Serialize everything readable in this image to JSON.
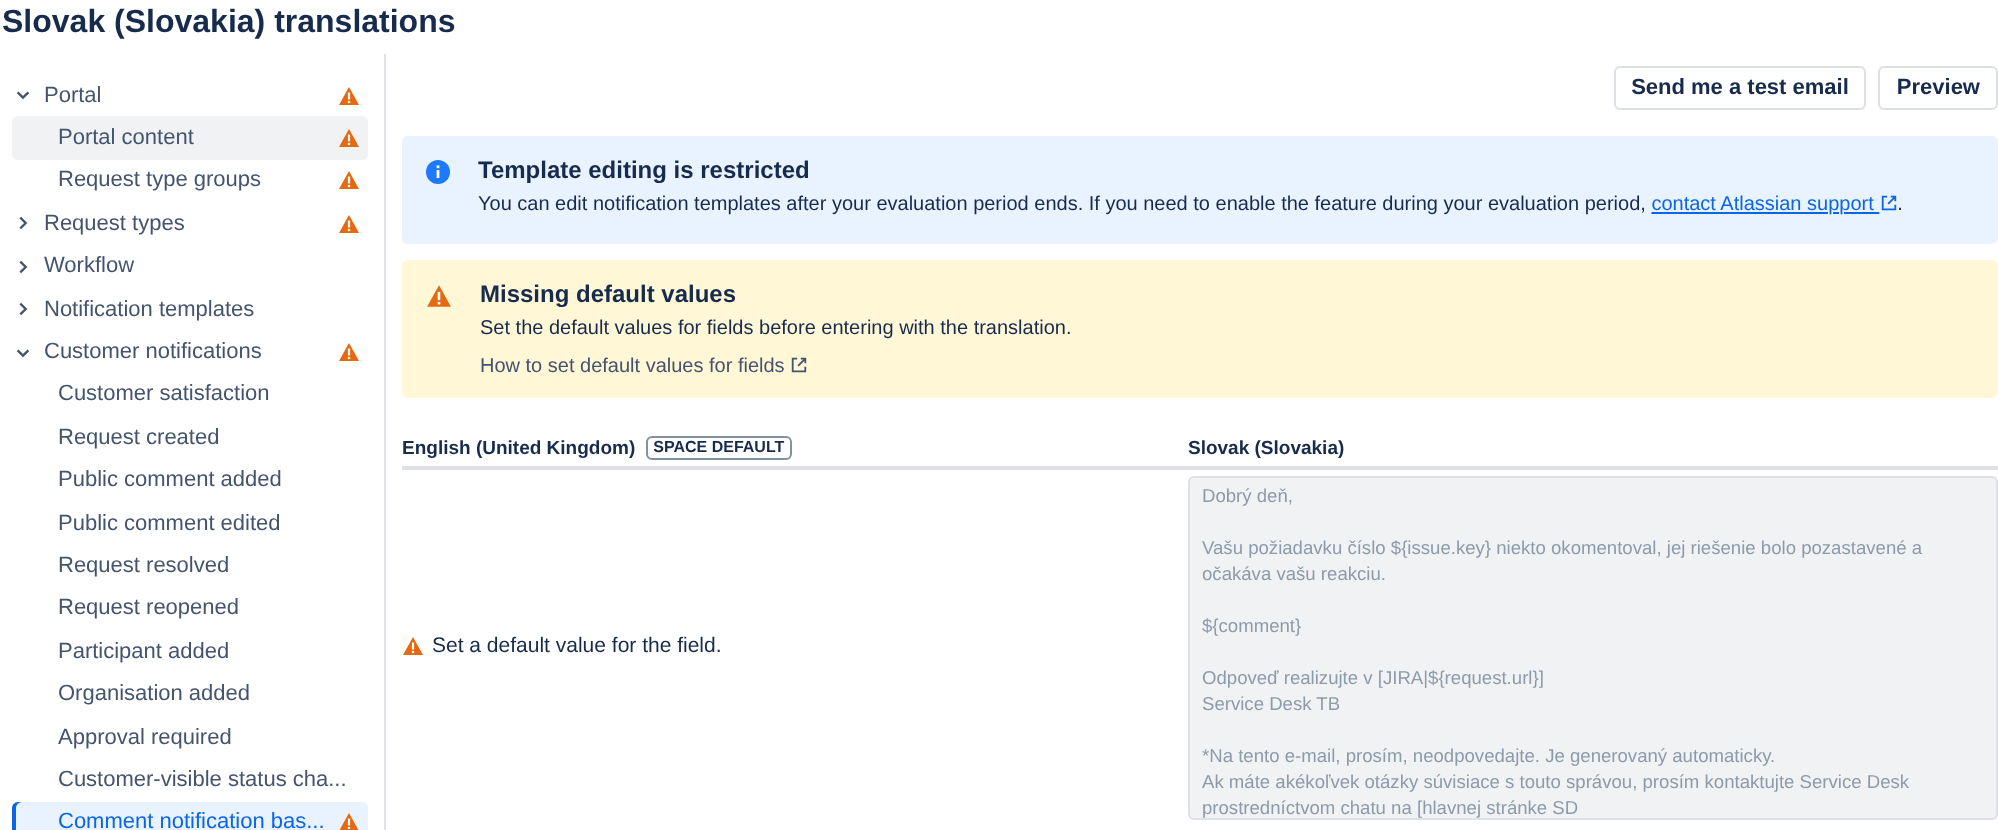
{
  "page_title": "Slovak (Slovakia) translations",
  "sidebar": {
    "items": [
      {
        "label": "Portal",
        "expanded": true,
        "warning": true,
        "selected": false,
        "hovered": false,
        "children": [
          {
            "label": "Portal content",
            "warning": true,
            "selected": false,
            "hovered": true
          },
          {
            "label": "Request type groups",
            "warning": true,
            "selected": false,
            "hovered": false
          }
        ]
      },
      {
        "label": "Request types",
        "expanded": false,
        "warning": true,
        "selected": false,
        "hovered": false
      },
      {
        "label": "Workflow",
        "expanded": false,
        "warning": false,
        "selected": false,
        "hovered": false
      },
      {
        "label": "Notification templates",
        "expanded": false,
        "warning": false,
        "selected": false,
        "hovered": false
      },
      {
        "label": "Customer notifications",
        "expanded": true,
        "warning": true,
        "selected": false,
        "hovered": false,
        "children": [
          {
            "label": "Customer satisfaction",
            "warning": false,
            "selected": false,
            "hovered": false
          },
          {
            "label": "Request created",
            "warning": false,
            "selected": false,
            "hovered": false
          },
          {
            "label": "Public comment added",
            "warning": false,
            "selected": false,
            "hovered": false
          },
          {
            "label": "Public comment edited",
            "warning": false,
            "selected": false,
            "hovered": false
          },
          {
            "label": "Request resolved",
            "warning": false,
            "selected": false,
            "hovered": false
          },
          {
            "label": "Request reopened",
            "warning": false,
            "selected": false,
            "hovered": false
          },
          {
            "label": "Participant added",
            "warning": false,
            "selected": false,
            "hovered": false
          },
          {
            "label": "Organisation added",
            "warning": false,
            "selected": false,
            "hovered": false
          },
          {
            "label": "Approval required",
            "warning": false,
            "selected": false,
            "hovered": false
          },
          {
            "label": "Customer-visible status cha...",
            "warning": false,
            "selected": false,
            "hovered": false
          },
          {
            "label": "Comment notification bas...",
            "warning": true,
            "selected": true,
            "hovered": false
          }
        ]
      }
    ]
  },
  "actions": [
    "Send me a test email",
    "Preview"
  ],
  "banners": [
    {
      "kind": "info",
      "title": "Template editing is restricted",
      "text": "You can edit notification templates after your evaluation period ends. If you need to enable the feature during your evaluation period,",
      "link": "contact Atlassian support",
      "after": "."
    },
    {
      "kind": "warning",
      "title": "Missing default values",
      "text": "Set the default values for fields before entering with the translation.",
      "help_link": "How to set default values for fields"
    }
  ],
  "columns": {
    "source": {
      "label": "English (United Kingdom)",
      "badge": "SPACE DEFAULT"
    },
    "target": {
      "label": "Slovak (Slovakia)"
    }
  },
  "source_message": "Set a default value for the field.",
  "translation": {
    "disabled": true,
    "value": "Dobrý deň,\n\nVašu požiadavku číslo ${issue.key} niekto okomentoval, jej riešenie bolo pozastavené a očakáva vašu reakciu.\n\n${comment}\n\nOdpoveď realizujte v [JIRA|${request.url}]\nService Desk TB\n\n*Na tento e-mail, prosím, neodpovedajte. Je generovaný automaticky.\nAk máte akékoľvek otázky súvisiace s touto správou, prosím kontaktujte Service Desk\nprostredníctvom chatu na [hlavnej stránke SD"
  }
}
